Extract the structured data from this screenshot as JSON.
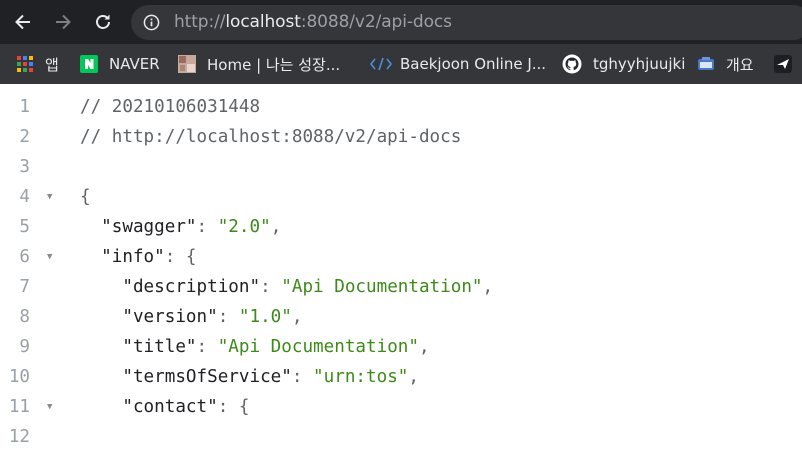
{
  "browser": {
    "url_scheme": "http://",
    "url_host": "localhost",
    "url_rest": ":8088/v2/api-docs"
  },
  "bookmarks": [
    {
      "label": "앱",
      "icon": "apps-grid-icon"
    },
    {
      "label": "NAVER",
      "icon": "naver-logo-icon"
    },
    {
      "label": "Home | 나는 성장...",
      "icon": "site-thumbnail-icon"
    },
    {
      "label": "Baekjoon Online J...",
      "icon": "code-brackets-icon"
    },
    {
      "label": "tghyyhjuujki",
      "icon": "github-icon"
    },
    {
      "label": "개요",
      "icon": "gcp-icon"
    }
  ],
  "code_lines": [
    {
      "n": "1",
      "fold": "",
      "parts": [
        {
          "t": "// 20210106031448",
          "c": "cm"
        }
      ]
    },
    {
      "n": "2",
      "fold": "",
      "parts": [
        {
          "t": "// http://localhost:8088/v2/api-docs",
          "c": "cm"
        }
      ]
    },
    {
      "n": "3",
      "fold": "",
      "parts": []
    },
    {
      "n": "4",
      "fold": "▼",
      "parts": [
        {
          "t": "{",
          "c": "pun"
        }
      ]
    },
    {
      "n": "5",
      "fold": "",
      "parts": [
        {
          "t": "  \"swagger\"",
          "c": "key"
        },
        {
          "t": ": ",
          "c": "pun"
        },
        {
          "t": "\"2.0\"",
          "c": "str"
        },
        {
          "t": ",",
          "c": "pun"
        }
      ]
    },
    {
      "n": "6",
      "fold": "▼",
      "parts": [
        {
          "t": "  \"info\"",
          "c": "key"
        },
        {
          "t": ": {",
          "c": "pun"
        }
      ]
    },
    {
      "n": "7",
      "fold": "",
      "parts": [
        {
          "t": "    \"description\"",
          "c": "key"
        },
        {
          "t": ": ",
          "c": "pun"
        },
        {
          "t": "\"Api Documentation\"",
          "c": "str"
        },
        {
          "t": ",",
          "c": "pun"
        }
      ]
    },
    {
      "n": "8",
      "fold": "",
      "parts": [
        {
          "t": "    \"version\"",
          "c": "key"
        },
        {
          "t": ": ",
          "c": "pun"
        },
        {
          "t": "\"1.0\"",
          "c": "str"
        },
        {
          "t": ",",
          "c": "pun"
        }
      ]
    },
    {
      "n": "9",
      "fold": "",
      "parts": [
        {
          "t": "    \"title\"",
          "c": "key"
        },
        {
          "t": ": ",
          "c": "pun"
        },
        {
          "t": "\"Api Documentation\"",
          "c": "str"
        },
        {
          "t": ",",
          "c": "pun"
        }
      ]
    },
    {
      "n": "10",
      "fold": "",
      "parts": [
        {
          "t": "    \"termsOfService\"",
          "c": "key"
        },
        {
          "t": ": ",
          "c": "pun"
        },
        {
          "t": "\"urn:tos\"",
          "c": "str"
        },
        {
          "t": ",",
          "c": "pun"
        }
      ]
    },
    {
      "n": "11",
      "fold": "▼",
      "parts": [
        {
          "t": "    \"contact\"",
          "c": "key"
        },
        {
          "t": ": {",
          "c": "pun"
        }
      ]
    },
    {
      "n": "12",
      "fold": "",
      "parts": []
    }
  ]
}
